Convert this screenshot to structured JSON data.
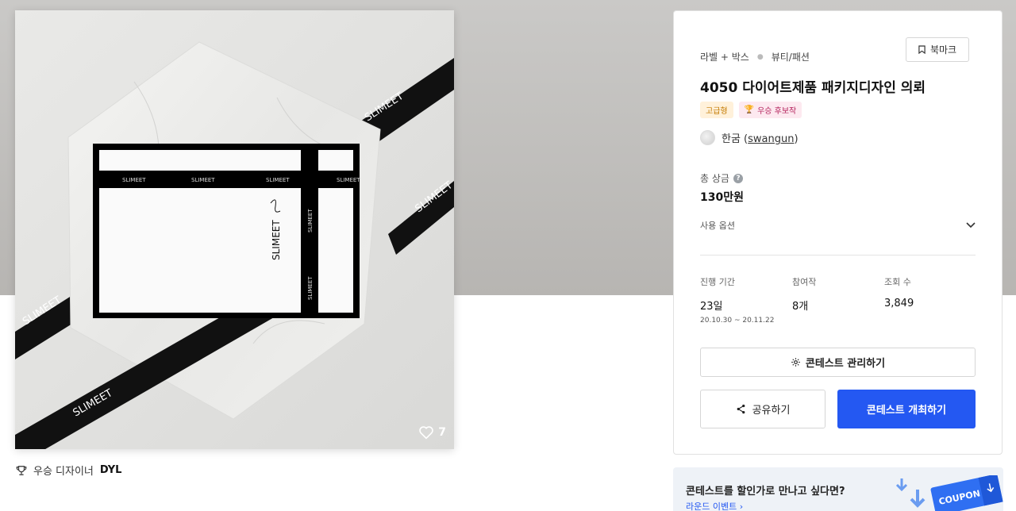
{
  "hero": {
    "brand_text": "SLIMEET",
    "like_count": "7"
  },
  "winner": {
    "prefix": "우승 디자이너",
    "name": "DYL"
  },
  "panel": {
    "category_1": "라벨 + 박스",
    "category_2": "뷰티/패션",
    "bookmark_label": "북마크",
    "title": "4050 다이어트제품 패키지디자인 의뢰",
    "badge_grade": "고급형",
    "badge_candidate": "우승 후보작",
    "host_name": "한굼",
    "host_id": "swangun",
    "prize_label": "총 상금",
    "prize_value": "130만원",
    "options_label": "사용 옵션",
    "stats": {
      "period_label": "진행 기간",
      "period_value": "23일",
      "period_range": "20.10.30 ~ 20.11.22",
      "entries_label": "참여작",
      "entries_value": "8개",
      "views_label": "조회 수",
      "views_value": "3,849"
    },
    "manage_label": "콘테스트 관리하기",
    "share_label": "공유하기",
    "host_button_label": "콘테스트 개최하기"
  },
  "promo": {
    "title": "콘테스트를 할인가로 만나고 싶다면?",
    "link_label": "라운드 이벤트",
    "coupon_text": "COUPON"
  },
  "colors": {
    "primary": "#2458f2",
    "grade_badge_bg": "#fff1da",
    "candidate_badge_bg": "#fde9f0"
  }
}
